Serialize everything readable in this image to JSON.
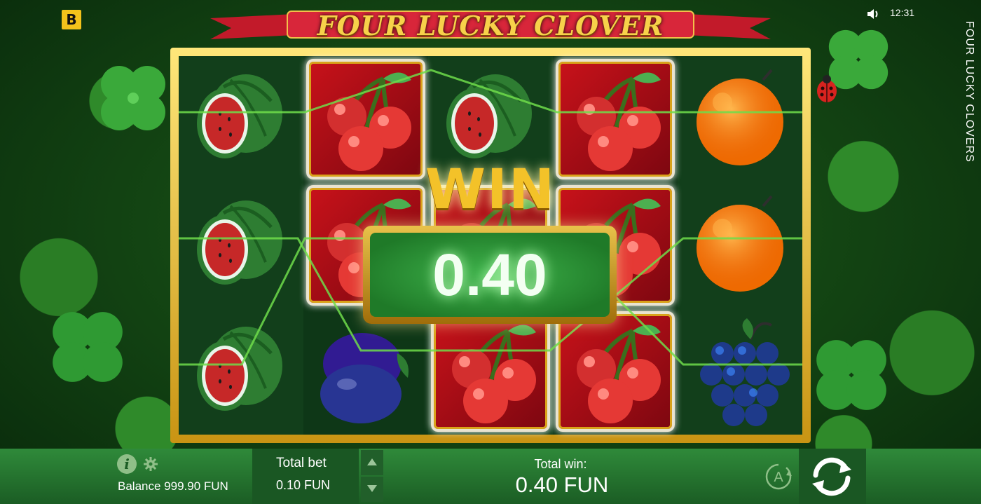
{
  "brand": {
    "logo_letter": "B"
  },
  "header": {
    "game_title": "FOUR LUCKY CLOVER",
    "clock": "12:31",
    "side_title": "FOUR LUCKY CLOVERS"
  },
  "reels": {
    "grid": [
      [
        "watermelon",
        "cherries",
        "watermelon",
        "cherries",
        "orange"
      ],
      [
        "watermelon",
        "cherries",
        "cherries",
        "cherries",
        "orange"
      ],
      [
        "watermelon",
        "plum",
        "cherries",
        "cherries",
        "grapes"
      ]
    ]
  },
  "win_popup": {
    "title": "WIN",
    "amount": "0.40"
  },
  "footer": {
    "balance": "Balance 999.90 FUN",
    "total_bet_label": "Total bet",
    "total_bet_value": "0.10 FUN",
    "total_win_label": "Total win:",
    "total_win_value": "0.40 FUN",
    "auto_label": "A"
  },
  "colors": {
    "gold": "#f3c229",
    "panel_green": "#1a5723",
    "win_green": "#2f9c3a"
  }
}
